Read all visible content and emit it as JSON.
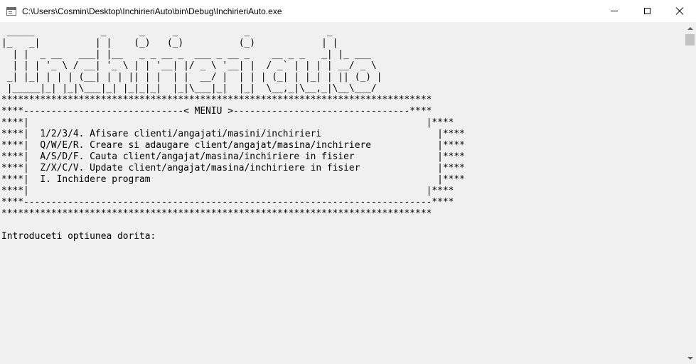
{
  "window": {
    "title": "C:\\Users\\Cosmin\\Desktop\\InchirieriAuto\\bin\\Debug\\InchirieriAuto.exe",
    "icon": "console-window-icon",
    "controls": {
      "minimize": "minimize-icon",
      "maximize": "maximize-icon",
      "close": "close-icon"
    }
  },
  "console": {
    "banner": [
      " _____            _      _     _            _              _",
      "|_   _|          | |    (_)   (_)          (_)            | |",
      "  | |  _ __   ___| |__   _ _ __ _  ___ _ __ _    __ _ _   _| |_ ___",
      "  | | | '_ \\ / __| '_ \\ | | '__| |/ _ \\ '__| |  / _` | | | | __/ _ \\",
      " _| |_| | | | (__| | | || | |  | |  __/ |  | | | (_| | |_| | || (_) |",
      " |_____|_| |_|\\___|_| |_|_|_|  |_|\\___|_|  |_|  \\__,_|\\__,_|\\__\\___/"
    ],
    "border_full": "******************************************************************************",
    "menu_header": "****-----------------------------< MENIU >--------------------------------****",
    "menu_blank": "****|                                                                        |****",
    "menu_items": [
      "****|  1/2/3/4. Afisare clienti/angajati/masini/inchirieri                     |****",
      "****|  Q/W/E/R. Creare si adaugare client/angajat/masina/inchiriere            |****",
      "****|  A/S/D/F. Cauta client/angajat/masina/inchiriere in fisier               |****",
      "****|  Z/X/C/V. Update client/angajat/masina/inchiriere in fisier              |****",
      "****|  I. Inchidere program                                                    |****"
    ],
    "menu_footer": "****--------------------------------------------------------------------------****",
    "prompt": "Introduceti optiunea dorita:"
  }
}
